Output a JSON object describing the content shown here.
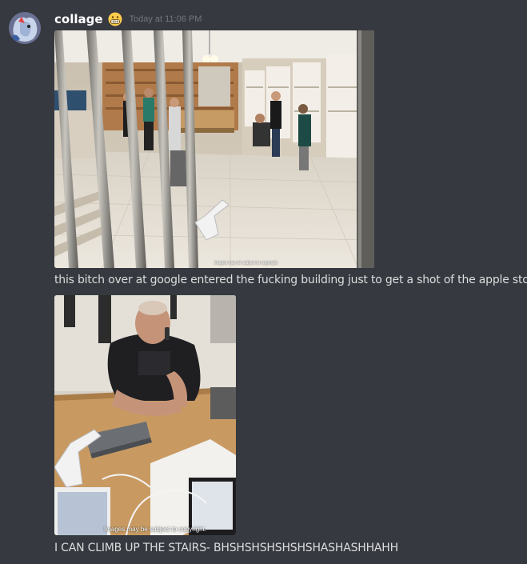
{
  "message": {
    "username": "collage",
    "username_emoji": "grimacing-face-emoji",
    "timestamp": "Today at 11:06 PM",
    "attachments": [
      {
        "kind": "street-view-image",
        "caption": "Images may be subject to copyright."
      },
      {
        "kind": "street-view-image",
        "caption": "Images may be subject to copyright."
      }
    ],
    "texts": [
      "this bitch over at google entered the fucking building just to get a shot of the apple store",
      "I CAN CLIMB UP THE STAIRS- BHSHSHSHSHSHSHASHASHHAHH"
    ]
  },
  "colors": {
    "background": "#36393f",
    "username": "#ffffff",
    "timestamp": "#72767d",
    "text": "#dcddde"
  }
}
